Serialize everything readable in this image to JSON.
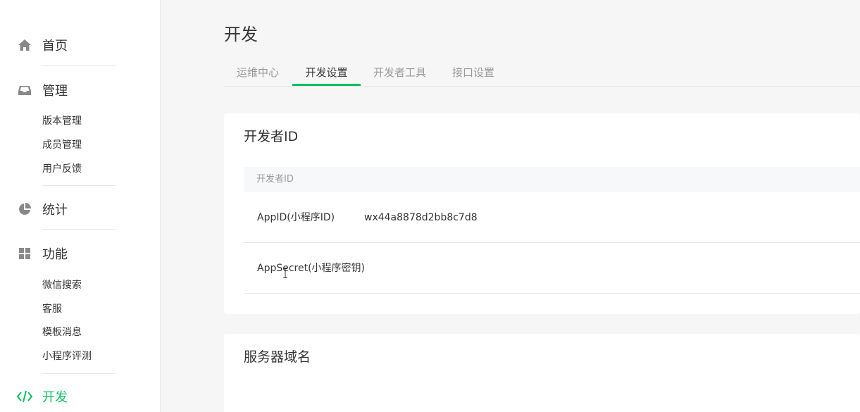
{
  "sidebar": {
    "sections": [
      {
        "label": "首页",
        "icon": "home-icon"
      },
      {
        "label": "管理",
        "icon": "inbox-icon",
        "items": [
          "版本管理",
          "成员管理",
          "用户反馈"
        ]
      },
      {
        "label": "统计",
        "icon": "pie-chart-icon"
      },
      {
        "label": "功能",
        "icon": "grid-icon",
        "items": [
          "微信搜索",
          "客服",
          "模板消息",
          "小程序评测"
        ]
      },
      {
        "label": "开发",
        "icon": "code-icon"
      }
    ],
    "active": "开发",
    "accent_color": "#07c160"
  },
  "main": {
    "title": "开发",
    "tabs": [
      {
        "label": "运维中心"
      },
      {
        "label": "开发设置"
      },
      {
        "label": "开发者工具"
      },
      {
        "label": "接口设置"
      }
    ],
    "active_tab": "开发设置",
    "developer_card": {
      "title": "开发者ID",
      "table_header": "开发者ID",
      "rows": [
        {
          "key": "AppID(小程序ID)",
          "value": "wx44a8878d2bb8c7d8"
        },
        {
          "key": "AppSecret(小程序密钥)",
          "value": ""
        }
      ]
    },
    "server_card": {
      "title": "服务器域名"
    }
  }
}
